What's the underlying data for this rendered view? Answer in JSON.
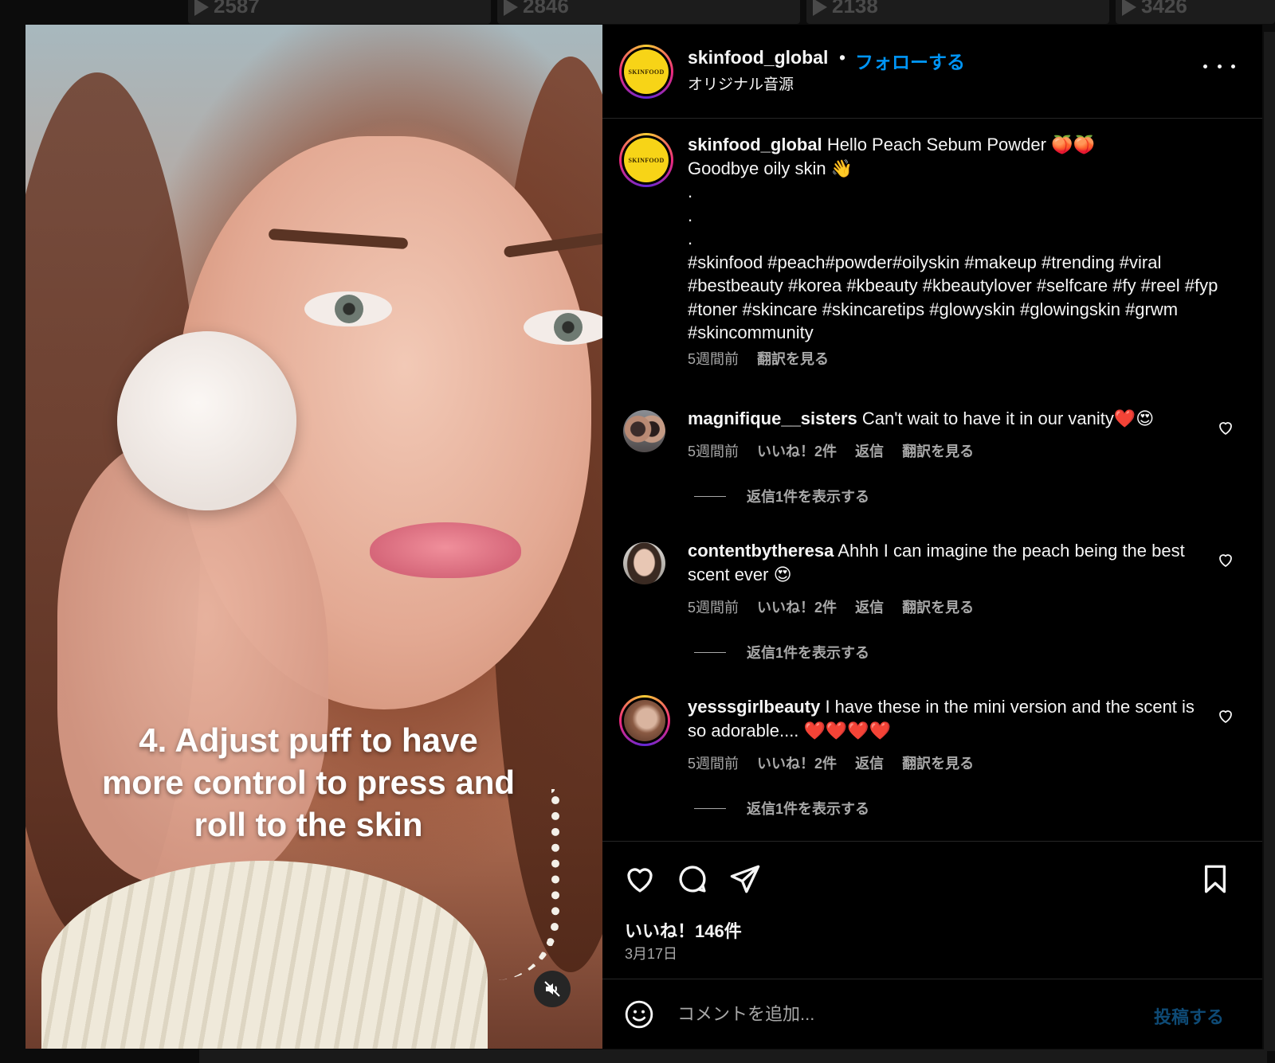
{
  "background": {
    "tiles": [
      {
        "count": "2587"
      },
      {
        "count": "2846"
      },
      {
        "count": "2138"
      },
      {
        "count": "3426"
      }
    ]
  },
  "media": {
    "caption_text": "4. Adjust puff to have more control to press and roll to the skin",
    "mute_icon": "speaker-muted-icon"
  },
  "header": {
    "username": "skinfood_global",
    "separator": "•",
    "follow_label": "フォローする",
    "audio_label": "オリジナル音源",
    "logo_text": "SKINFOOD",
    "more_icon": "more-horizontal-icon"
  },
  "post_caption": {
    "username": "skinfood_global",
    "line1": "Hello Peach Sebum Powder 🍑🍑",
    "line2": "Goodbye oily skin 👋",
    "dots": [
      ".",
      ".",
      "."
    ],
    "hashtags": "#skinfood #peach#powder#oilyskin #makeup #trending #viral #bestbeauty #korea #kbeauty #kbeautylover #selfcare #fy #reel #fyp #toner #skincare #skincaretips #glowyskin #glowingskin #grwm #skincommunity",
    "time": "5週間前",
    "translate": "翻訳を見る"
  },
  "comments": [
    {
      "username": "magnifique__sisters",
      "text": "Can't wait to have it in our vanity❤️😍",
      "time": "5週間前",
      "likes": "いいね！2件",
      "reply": "返信",
      "translate": "翻訳を見る",
      "view_replies": "返信1件を表示する"
    },
    {
      "username": "contentbytheresa",
      "text": "Ahhh I can imagine the peach being the best scent ever 😍",
      "time": "5週間前",
      "likes": "いいね！2件",
      "reply": "返信",
      "translate": "翻訳を見る",
      "view_replies": "返信1件を表示する"
    },
    {
      "username": "yesssgirlbeauty",
      "text": "I have these in the mini version and the scent is so adorable.... ❤️❤️❤️❤️",
      "time": "5週間前",
      "likes": "いいね！2件",
      "reply": "返信",
      "translate": "翻訳を見る",
      "view_replies": "返信1件を表示する"
    }
  ],
  "actions": {
    "like_icon": "heart-icon",
    "comment_icon": "comment-bubble-icon",
    "share_icon": "paper-plane-icon",
    "save_icon": "bookmark-icon",
    "likes_count": "いいね！146件",
    "date": "3月17日"
  },
  "compose": {
    "emoji_icon": "smiley-icon",
    "placeholder": "コメントを追加...",
    "post_label": "投稿する"
  },
  "colors": {
    "accent_blue": "#0095f6",
    "muted_text": "#a8a8a8",
    "brand_yellow": "#f7d417"
  }
}
